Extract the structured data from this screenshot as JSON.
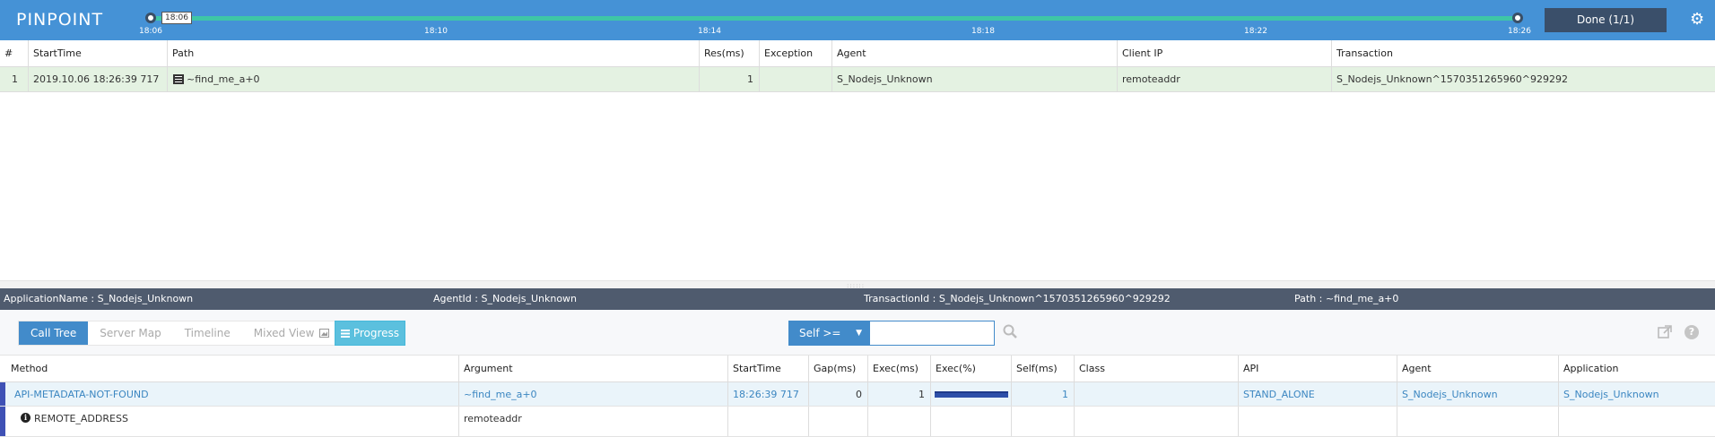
{
  "topbar": {
    "logo": "PINPOINT",
    "range_start_tooltip": "18:06",
    "ticks": [
      "18:06",
      "18:10",
      "18:14",
      "18:18",
      "18:22",
      "18:26"
    ],
    "done_button": "Done (1/1)"
  },
  "transaction_list": {
    "columns": [
      "#",
      "StartTime",
      "Path",
      "Res(ms)",
      "Exception",
      "Agent",
      "Client IP",
      "Transaction"
    ],
    "rows": [
      {
        "index": "1",
        "start_time": "2019.10.06 18:26:39 717",
        "path": "~find_me_a+0",
        "res_ms": "1",
        "exception": "",
        "agent": "S_Nodejs_Unknown",
        "client_ip": "remoteaddr",
        "transaction": "S_Nodejs_Unknown^1570351265960^929292"
      }
    ]
  },
  "infobar": {
    "application_name": "ApplicationName : S_Nodejs_Unknown",
    "agent_id": "AgentId : S_Nodejs_Unknown",
    "transaction_id": "TransactionId : S_Nodejs_Unknown^1570351265960^929292",
    "path": "Path : ~find_me_a+0"
  },
  "toolbar": {
    "tabs": [
      "Call Tree",
      "Server Map",
      "Timeline",
      "Mixed View"
    ],
    "active_tab": "Call Tree",
    "progress_button": "Progress",
    "filter_select": "Self >=",
    "filter_value": ""
  },
  "call_tree": {
    "columns": [
      "Method",
      "Argument",
      "StartTime",
      "Gap(ms)",
      "Exec(ms)",
      "Exec(%)",
      "Self(ms)",
      "Class",
      "API",
      "Agent",
      "Application"
    ],
    "rows": [
      {
        "method": "API-METADATA-NOT-FOUND",
        "argument": "~find_me_a+0",
        "start_time": "18:26:39 717",
        "gap": "0",
        "exec": "1",
        "exec_pct": 1.0,
        "self": "1",
        "class": "",
        "api": "STAND_ALONE",
        "agent": "S_Nodejs_Unknown",
        "application": "S_Nodejs_Unknown"
      },
      {
        "method": "REMOTE_ADDRESS",
        "argument": "remoteaddr",
        "start_time": "",
        "gap": "",
        "exec": "",
        "self": "",
        "class": "",
        "api": "",
        "agent": "",
        "application": ""
      }
    ]
  },
  "colors": {
    "topbar": "#4592d6",
    "timeline_track": "#3ec6a6",
    "selected_row": "#e4f2e2",
    "infobar": "#4f5b6e",
    "accent": "#428bca",
    "progress": "#5bc0de"
  },
  "icons": {
    "settings": "gear-icon",
    "path": "list-icon",
    "search": "search-icon",
    "popout": "external-link-icon",
    "help": "question-icon",
    "info": "info-icon",
    "mixed_view": "image-icon",
    "progress": "list-icon"
  }
}
